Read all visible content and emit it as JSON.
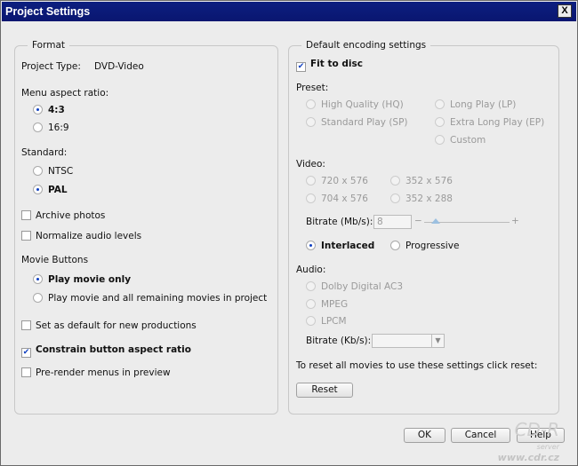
{
  "window": {
    "title": "Project Settings",
    "close": "X"
  },
  "format": {
    "legend": "Format",
    "project_type_label": "Project Type:",
    "project_type_value": "DVD-Video",
    "menu_aspect_label": "Menu aspect ratio:",
    "aspect_options": [
      "4:3",
      "16:9"
    ],
    "aspect_selected": "4:3",
    "standard_label": "Standard:",
    "standard_options": [
      "NTSC",
      "PAL"
    ],
    "standard_selected": "PAL",
    "archive_photos": "Archive photos",
    "normalize_audio": "Normalize audio levels",
    "movie_buttons_label": "Movie Buttons",
    "movie_options": [
      "Play movie only",
      "Play movie and all remaining movies in project"
    ],
    "set_default": "Set as default for new productions",
    "constrain": "Constrain button aspect ratio",
    "prerender": "Pre-render menus in preview",
    "checked": {
      "archive_photos": false,
      "normalize_audio": false,
      "set_default": false,
      "constrain": true,
      "prerender": false
    }
  },
  "encoding": {
    "legend": "Default encoding settings",
    "fit_to_disc": "Fit to disc",
    "fit_checked": true,
    "preset_label": "Preset:",
    "presets": [
      "High Quality (HQ)",
      "Long Play (LP)",
      "Standard Play (SP)",
      "Extra Long Play (EP)",
      "Custom"
    ],
    "video_label": "Video:",
    "resolutions": [
      "720 x 576",
      "352 x 576",
      "704 x 576",
      "352 x 288"
    ],
    "video_bitrate_label": "Bitrate (Mb/s):",
    "video_bitrate_value": "8",
    "slider_minus": "−",
    "slider_plus": "+",
    "scan_options": [
      "Interlaced",
      "Progressive"
    ],
    "scan_selected": "Interlaced",
    "audio_label": "Audio:",
    "audio_options": [
      "Dolby Digital AC3",
      "MPEG",
      "LPCM"
    ],
    "audio_bitrate_label": "Bitrate (Kb/s):",
    "audio_bitrate_value": "",
    "reset_text": "To reset all movies to use these settings click reset:",
    "reset_button": "Reset"
  },
  "buttons": {
    "ok": "OK",
    "cancel": "Cancel",
    "help": "Help"
  },
  "watermark": {
    "logo": "CD-R",
    "sub": "server",
    "url": "www.cdr.cz"
  }
}
